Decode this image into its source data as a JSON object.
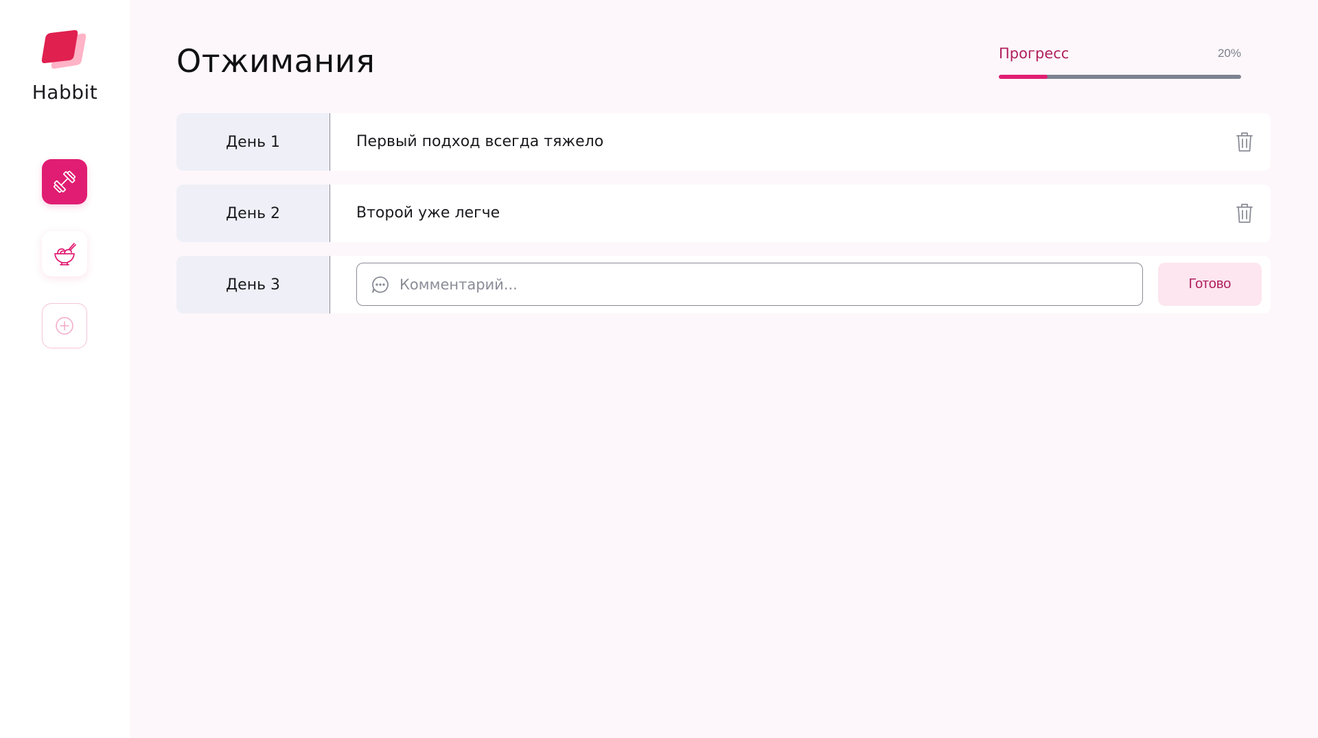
{
  "brand": {
    "name": "Habbit",
    "accent": "#e01d72"
  },
  "sidebar": {
    "items": [
      {
        "icon": "dumbbell-icon",
        "state": "active"
      },
      {
        "icon": "bowl-icon",
        "state": "inactive"
      },
      {
        "icon": "plus-circle-icon",
        "state": "add"
      }
    ]
  },
  "habit": {
    "title": "Отжимания"
  },
  "progress": {
    "label": "Прогресс",
    "value_text": "20%",
    "fraction": 0.2
  },
  "days": [
    {
      "label": "День 1",
      "comment": "Первый подход всегда тяжело"
    },
    {
      "label": "День 2",
      "comment": "Второй уже легче"
    }
  ],
  "new_day": {
    "label": "День 3",
    "input_placeholder": "Комментарий...",
    "input_value": "",
    "submit_label": "Готово"
  }
}
